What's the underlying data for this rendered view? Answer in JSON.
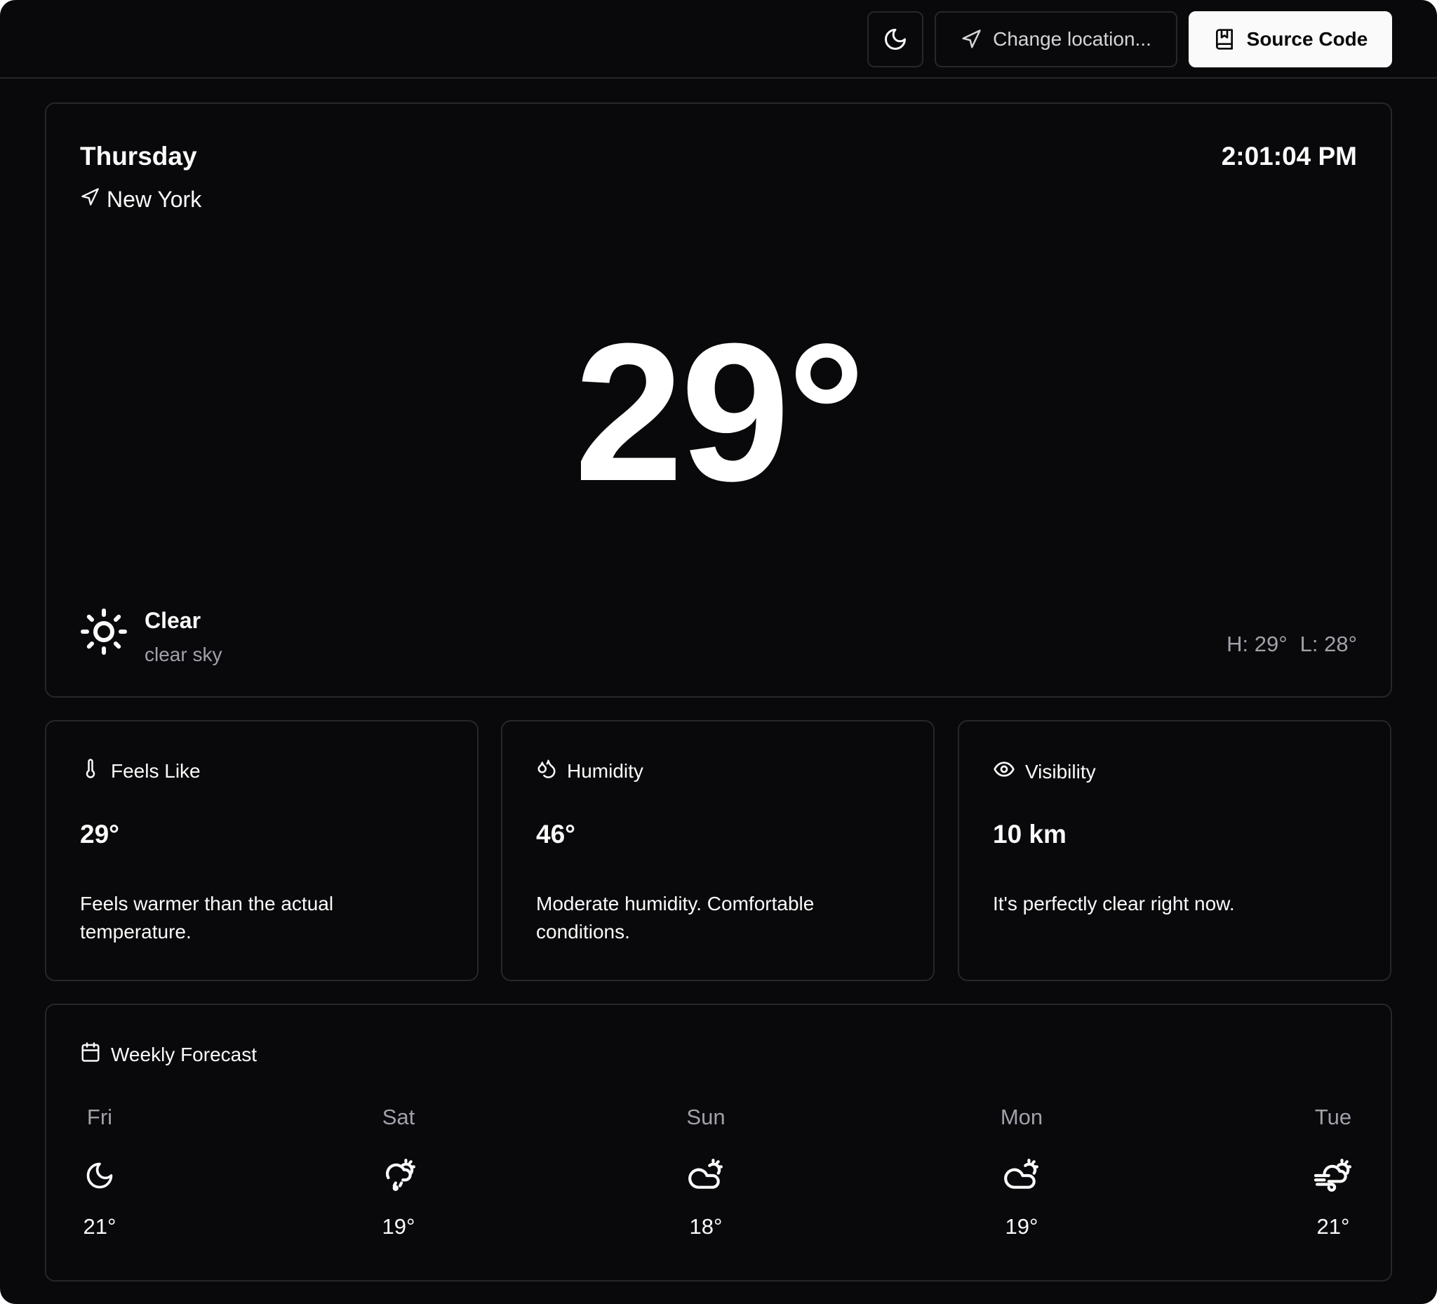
{
  "topbar": {
    "theme_icon": "moon-icon",
    "change_location": {
      "icon": "navigation-icon",
      "label": "Change location..."
    },
    "source_code": {
      "icon": "book-icon",
      "label": "Source Code"
    }
  },
  "current": {
    "day": "Thursday",
    "time": "2:01:04 PM",
    "location": "New York",
    "temperature": "29°",
    "condition": "Clear",
    "description": "clear sky",
    "condition_icon": "sun-icon",
    "high": "H: 29°",
    "low": "L: 28°"
  },
  "stats": [
    {
      "icon": "thermometer-icon",
      "label": "Feels Like",
      "value": "29°",
      "description": "Feels warmer than the actual temperature."
    },
    {
      "icon": "droplets-icon",
      "label": "Humidity",
      "value": "46°",
      "description": "Moderate humidity. Comfortable conditions."
    },
    {
      "icon": "eye-icon",
      "label": "Visibility",
      "value": "10 km",
      "description": "It's perfectly clear right now."
    }
  ],
  "weekly": {
    "title": "Weekly Forecast",
    "icon": "calendar-icon",
    "days": [
      {
        "day": "Fri",
        "icon": "moon-icon",
        "temp": "21°"
      },
      {
        "day": "Sat",
        "icon": "cloud-rain-sun-icon",
        "temp": "19°"
      },
      {
        "day": "Sun",
        "icon": "cloud-sun-icon",
        "temp": "18°"
      },
      {
        "day": "Mon",
        "icon": "cloud-sun-icon",
        "temp": "19°"
      },
      {
        "day": "Tue",
        "icon": "wind-cloud-sun-icon",
        "temp": "21°"
      }
    ]
  },
  "colors": {
    "background": "#09090b",
    "border": "#27272a",
    "text": "#fafafa",
    "muted": "#a1a1aa"
  }
}
